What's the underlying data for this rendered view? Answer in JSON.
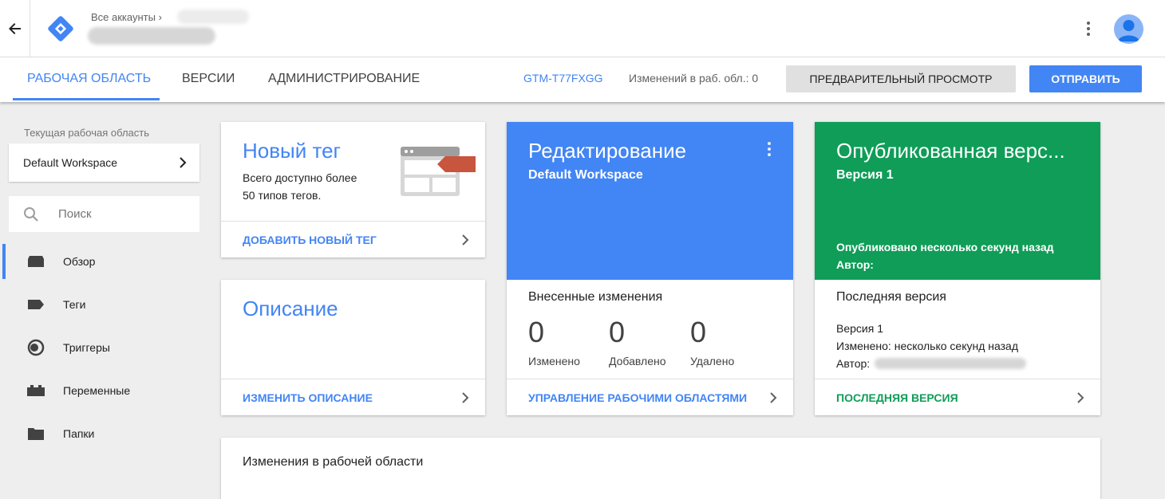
{
  "header": {
    "breadcrumb_label": "Все аккаунты ›",
    "more_icon": "more-vert-icon",
    "avatar_icon": "account-circle-icon"
  },
  "nav": {
    "tabs": [
      {
        "label": "РАБОЧАЯ ОБЛАСТЬ",
        "active": true
      },
      {
        "label": "ВЕРСИИ",
        "active": false
      },
      {
        "label": "АДМИНИСТРИРОВАНИЕ",
        "active": false
      }
    ],
    "container_id": "GTM-T77FXGG",
    "changes_text": "Изменений в раб. обл.: 0",
    "preview_label": "ПРЕДВАРИТЕЛЬНЫЙ ПРОСМОТР",
    "submit_label": "ОТПРАВИТЬ"
  },
  "sidebar": {
    "workspace_label": "Текущая рабочая область",
    "workspace_name": "Default Workspace",
    "search_placeholder": "Поиск",
    "items": [
      {
        "label": "Обзор",
        "icon": "overview-icon",
        "active": true
      },
      {
        "label": "Теги",
        "icon": "tag-icon",
        "active": false
      },
      {
        "label": "Триггеры",
        "icon": "trigger-icon",
        "active": false
      },
      {
        "label": "Переменные",
        "icon": "variable-icon",
        "active": false
      },
      {
        "label": "Папки",
        "icon": "folder-icon",
        "active": false
      }
    ]
  },
  "new_tag_card": {
    "title": "Новый тег",
    "line1": "Всего доступно более",
    "line2": "50 типов тегов.",
    "footer": "ДОБАВИТЬ НОВЫЙ ТЕГ"
  },
  "description_card": {
    "title": "Описание",
    "footer": "ИЗМЕНИТЬ ОПИСАНИЕ"
  },
  "editing_card": {
    "title": "Редактирование",
    "subtitle": "Default Workspace",
    "section_title": "Внесенные изменения",
    "stats": [
      {
        "value": "0",
        "label": "Изменено"
      },
      {
        "value": "0",
        "label": "Добавлено"
      },
      {
        "value": "0",
        "label": "Удалено"
      }
    ],
    "footer": "УПРАВЛЕНИЕ РАБОЧИМИ ОБЛАСТЯМИ",
    "color": "#4285f4"
  },
  "published_card": {
    "title": "Опубликованная верс...",
    "subtitle": "Версия 1",
    "published_text": "Опубликовано несколько секунд назад",
    "author_text": "Автор:",
    "section_title": "Последняя версия",
    "version_line": "Версия 1",
    "changed_line": "Изменено: несколько секунд назад",
    "author_line": "Автор:",
    "footer": "ПОСЛЕДНЯЯ ВЕРСИЯ",
    "color": "#0f9d58"
  },
  "changes_panel": {
    "title": "Изменения в рабочей области"
  }
}
